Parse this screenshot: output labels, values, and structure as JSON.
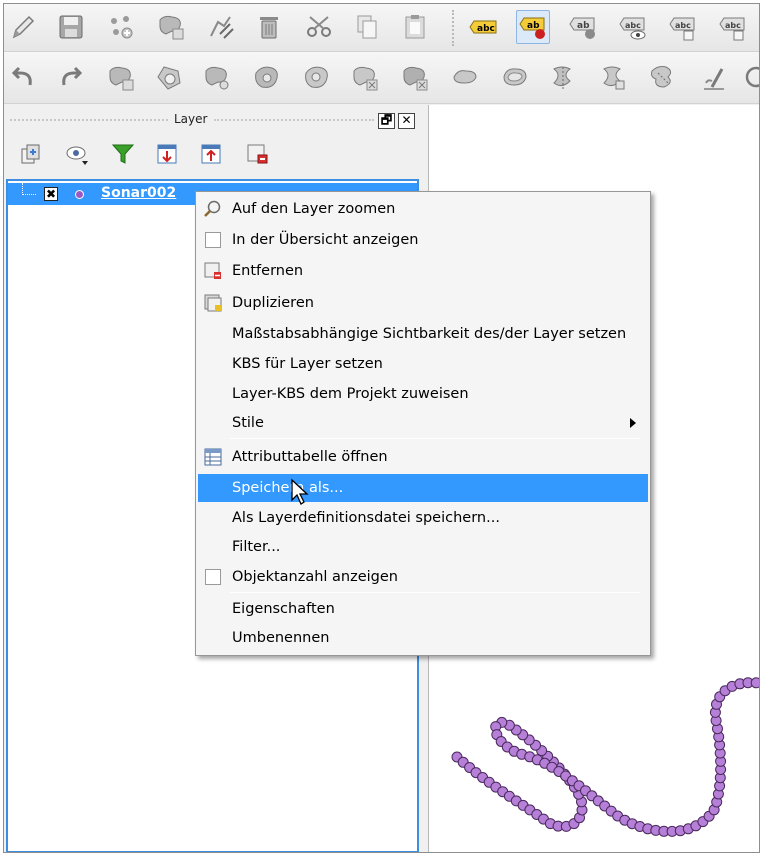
{
  "toolbar_row1": {
    "icons": [
      "pencil-icon",
      "save-edits-icon",
      "add-feature-icon",
      "move-feature-icon",
      "node-tool-icon",
      "delete-icon",
      "cut-icon",
      "copy-icon",
      "paste-icon",
      "label-icon",
      "pin-label-icon",
      "show-label-icon",
      "hide-label-icon",
      "move-label-icon",
      "rotate-label-icon"
    ],
    "label_text": "abc",
    "label_text_short": "ab"
  },
  "toolbar_row2": {
    "icons": [
      "undo-icon",
      "redo-icon",
      "simplify-icon",
      "add-ring-icon",
      "add-part-icon",
      "fill-ring-icon",
      "delete-ring-icon",
      "delete-part-icon",
      "reshape-icon",
      "offset-curve-icon",
      "split-features-icon",
      "split-parts-icon",
      "merge-selected-icon",
      "merge-attributes-icon",
      "rotate-symbol-icon",
      "zoom-icon"
    ]
  },
  "layer_panel": {
    "title": "Layer",
    "tools": [
      "add-group-icon",
      "visibility-icon",
      "filter-icon",
      "expand-all-icon",
      "collapse-all-icon",
      "remove-layer-icon"
    ],
    "float_button": "🗗",
    "close_button": "✕",
    "layers": [
      {
        "name": "Sonar002",
        "checked": "✖",
        "color": "#9b59c8"
      }
    ]
  },
  "context_menu": {
    "items": [
      {
        "label": "Auf den Layer zoomen",
        "icon": "zoom-layer-icon"
      },
      {
        "label": "In der Übersicht anzeigen",
        "icon": "checkbox-icon"
      },
      {
        "label": "Entfernen",
        "icon": "remove-layer-icon"
      },
      {
        "label": "Duplizieren",
        "icon": "duplicate-layer-icon"
      },
      {
        "label": "Maßstabsabhängige Sichtbarkeit des/der Layer setzen",
        "icon": ""
      },
      {
        "label": "KBS für Layer setzen",
        "icon": ""
      },
      {
        "label": "Layer-KBS dem Projekt zuweisen",
        "icon": ""
      },
      {
        "label": "Stile",
        "icon": "",
        "submenu": true
      },
      {
        "label": "Attributtabelle öffnen",
        "icon": "attribute-table-icon"
      },
      {
        "label": "Speichern als...",
        "icon": "",
        "highlighted": true
      },
      {
        "label": "Als Layerdefinitionsdatei speichern...",
        "icon": ""
      },
      {
        "label": "Filter...",
        "icon": ""
      },
      {
        "label": "Objektanzahl anzeigen",
        "icon": "checkbox-icon"
      },
      {
        "label": "Eigenschaften",
        "icon": ""
      },
      {
        "label": "Umbenennen",
        "icon": ""
      }
    ]
  },
  "colors": {
    "selection": "#3399ff",
    "point_fill": "#b67fd8",
    "point_stroke": "#4a2a5c"
  }
}
